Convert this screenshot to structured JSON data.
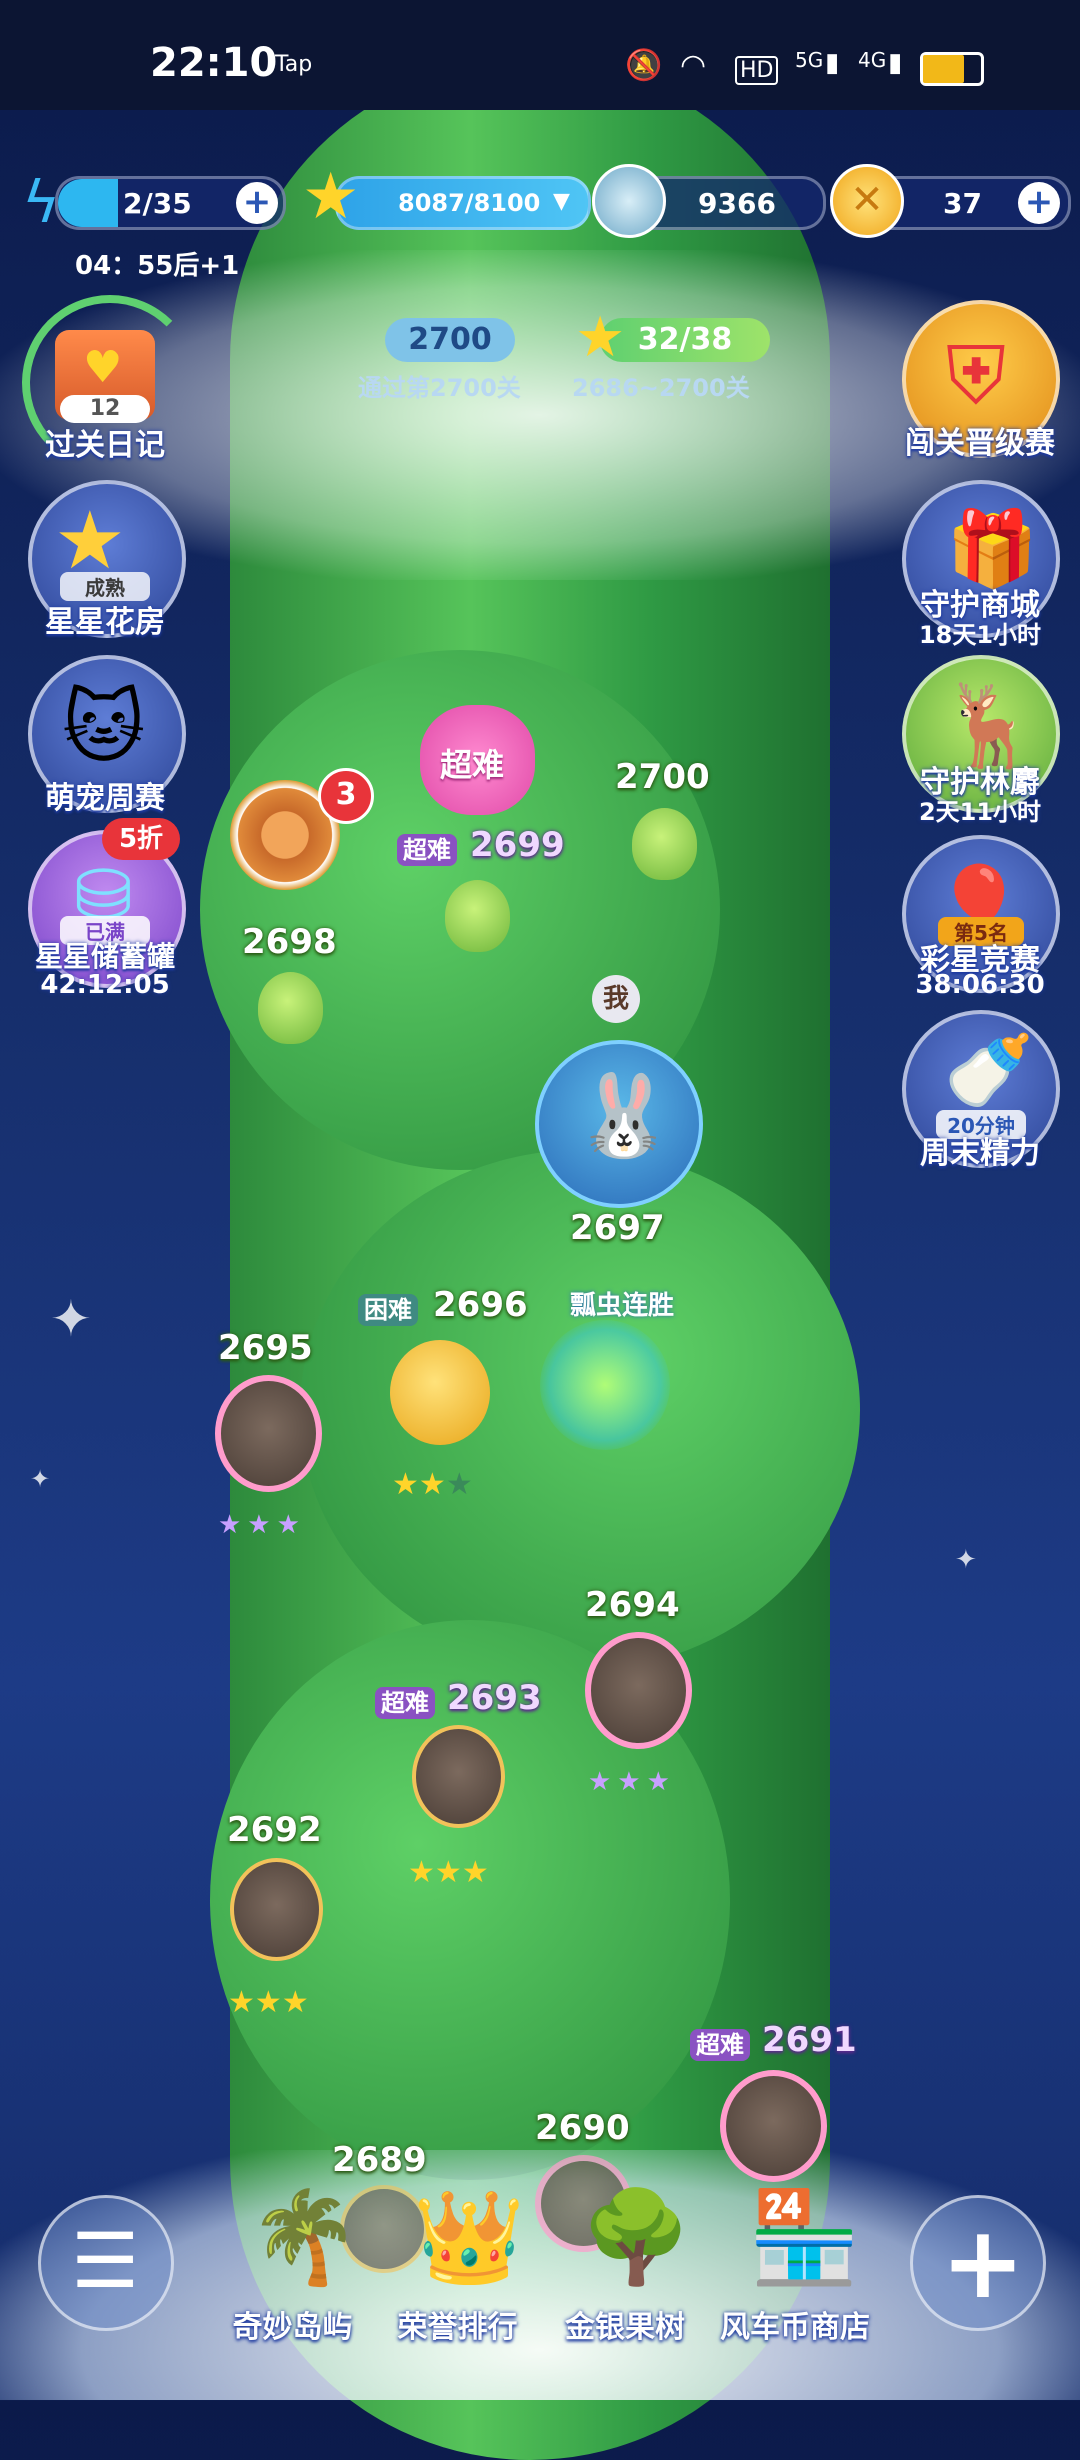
{
  "status_bar": {
    "time": "22:10",
    "tap_label": "Tap",
    "net_hd": "HD",
    "net_5g": "5G",
    "net_4g": "4G"
  },
  "top_resources": {
    "energy": "2/35",
    "energy_timer": "04：55后+1",
    "star_progress": "8087/8100",
    "coins_blue": "9366",
    "coins_gold": "37"
  },
  "level_goal": {
    "target_level": "2700",
    "target_caption": "通过第2700关",
    "stars_count": "32/38",
    "stars_caption": "2686~2700关"
  },
  "left_side": {
    "diary": {
      "label": "过关日记",
      "badge": "12"
    },
    "flower_house": {
      "label": "星星花房",
      "tag": "成熟"
    },
    "pet_weekly": {
      "label": "萌宠周赛"
    },
    "star_jar": {
      "label": "星星储蓄罐",
      "tag": "已满",
      "sale": "5折",
      "timer": "42:12:05"
    }
  },
  "right_side": {
    "promotion": {
      "label": "闯关晋级赛"
    },
    "guard_shop": {
      "label": "守护商城",
      "timer": "18天1小时"
    },
    "guard_forest": {
      "label": "守护林麝",
      "timer": "2天11小时"
    },
    "rainbow_race": {
      "label": "彩星竞赛",
      "rank": "第5名",
      "timer": "38:06:30"
    },
    "weekend_energy": {
      "label": "周末精力",
      "tag": "20分钟"
    }
  },
  "levels": {
    "spin_badge": "3",
    "super_hard_flower": "超难",
    "l2700": "2700",
    "l2699": "2699",
    "l2699_tag": "超难",
    "l2698": "2698",
    "l2697": "2697",
    "me_label": "我",
    "l2697_tag": "瓢虫连胜",
    "l2696": "2696",
    "l2696_tag": "困难",
    "l2695": "2695",
    "l2694": "2694",
    "l2693": "2693",
    "l2693_tag": "超难",
    "l2692": "2692",
    "l2691": "2691",
    "l2691_tag": "超难",
    "l2690": "2690",
    "l2689": "2689"
  },
  "bottom_nav": {
    "island": "奇妙岛屿",
    "ranking": "荣誉排行",
    "fruit_tree": "金银果树",
    "windmill_shop": "风车币商店"
  },
  "colors": {
    "accent": "#ffd42a",
    "hard_tag": "#8a52c2",
    "stalk": "#3aa84a"
  }
}
